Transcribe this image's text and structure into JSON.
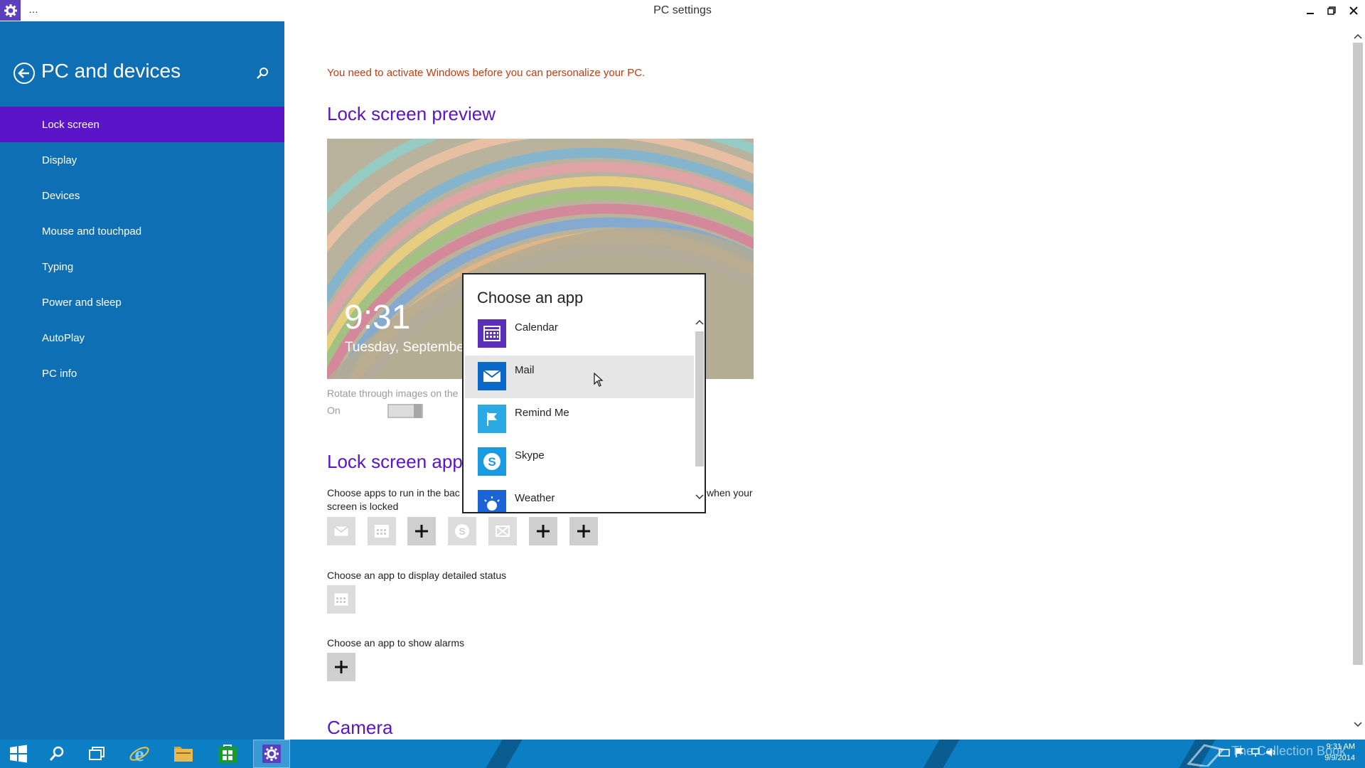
{
  "window": {
    "title": "PC settings",
    "menu_glyph": "…"
  },
  "sidebar": {
    "title": "PC and devices",
    "items": [
      {
        "label": "Lock screen",
        "selected": true
      },
      {
        "label": "Display"
      },
      {
        "label": "Devices"
      },
      {
        "label": "Mouse and touchpad"
      },
      {
        "label": "Typing"
      },
      {
        "label": "Power and sleep"
      },
      {
        "label": "AutoPlay"
      },
      {
        "label": "PC info"
      }
    ]
  },
  "main": {
    "activation_warning": "You need to activate Windows before you can personalize your PC.",
    "preview_heading": "Lock screen preview",
    "preview_time": "9:31",
    "preview_date": "Tuesday, September",
    "rotate_label": "Rotate through images on the",
    "rotate_state": "On",
    "apps_heading": "Lock screen apps",
    "apps_desc_1": "Choose apps to run in the bac",
    "apps_desc_2": "when your",
    "apps_desc_3": "screen is locked",
    "detailed_status_label": "Choose an app to display detailed status",
    "alarms_label": "Choose an app to show alarms",
    "camera_heading": "Camera"
  },
  "popup": {
    "title": "Choose an app",
    "apps": [
      {
        "label": "Calendar",
        "icon": "calendar-icon",
        "color": "#5b2fb8"
      },
      {
        "label": "Mail",
        "icon": "mail-icon",
        "color": "#0a68c9"
      },
      {
        "label": "Remind Me",
        "icon": "flag-icon",
        "color": "#2aa9e4"
      },
      {
        "label": "Skype",
        "icon": "skype-icon",
        "color": "#1a9ae0"
      },
      {
        "label": "Weather",
        "icon": "weather-icon",
        "color": "#1c63d6"
      }
    ]
  },
  "taskbar": {
    "watermark": "The Collection Book",
    "time": "9:31 AM",
    "date": "9/9/2014"
  },
  "colors": {
    "sidebar": "#0f6fb5",
    "accent": "#5b14c7",
    "warning": "#c73a0f",
    "taskbar": "#0c7fc4"
  }
}
